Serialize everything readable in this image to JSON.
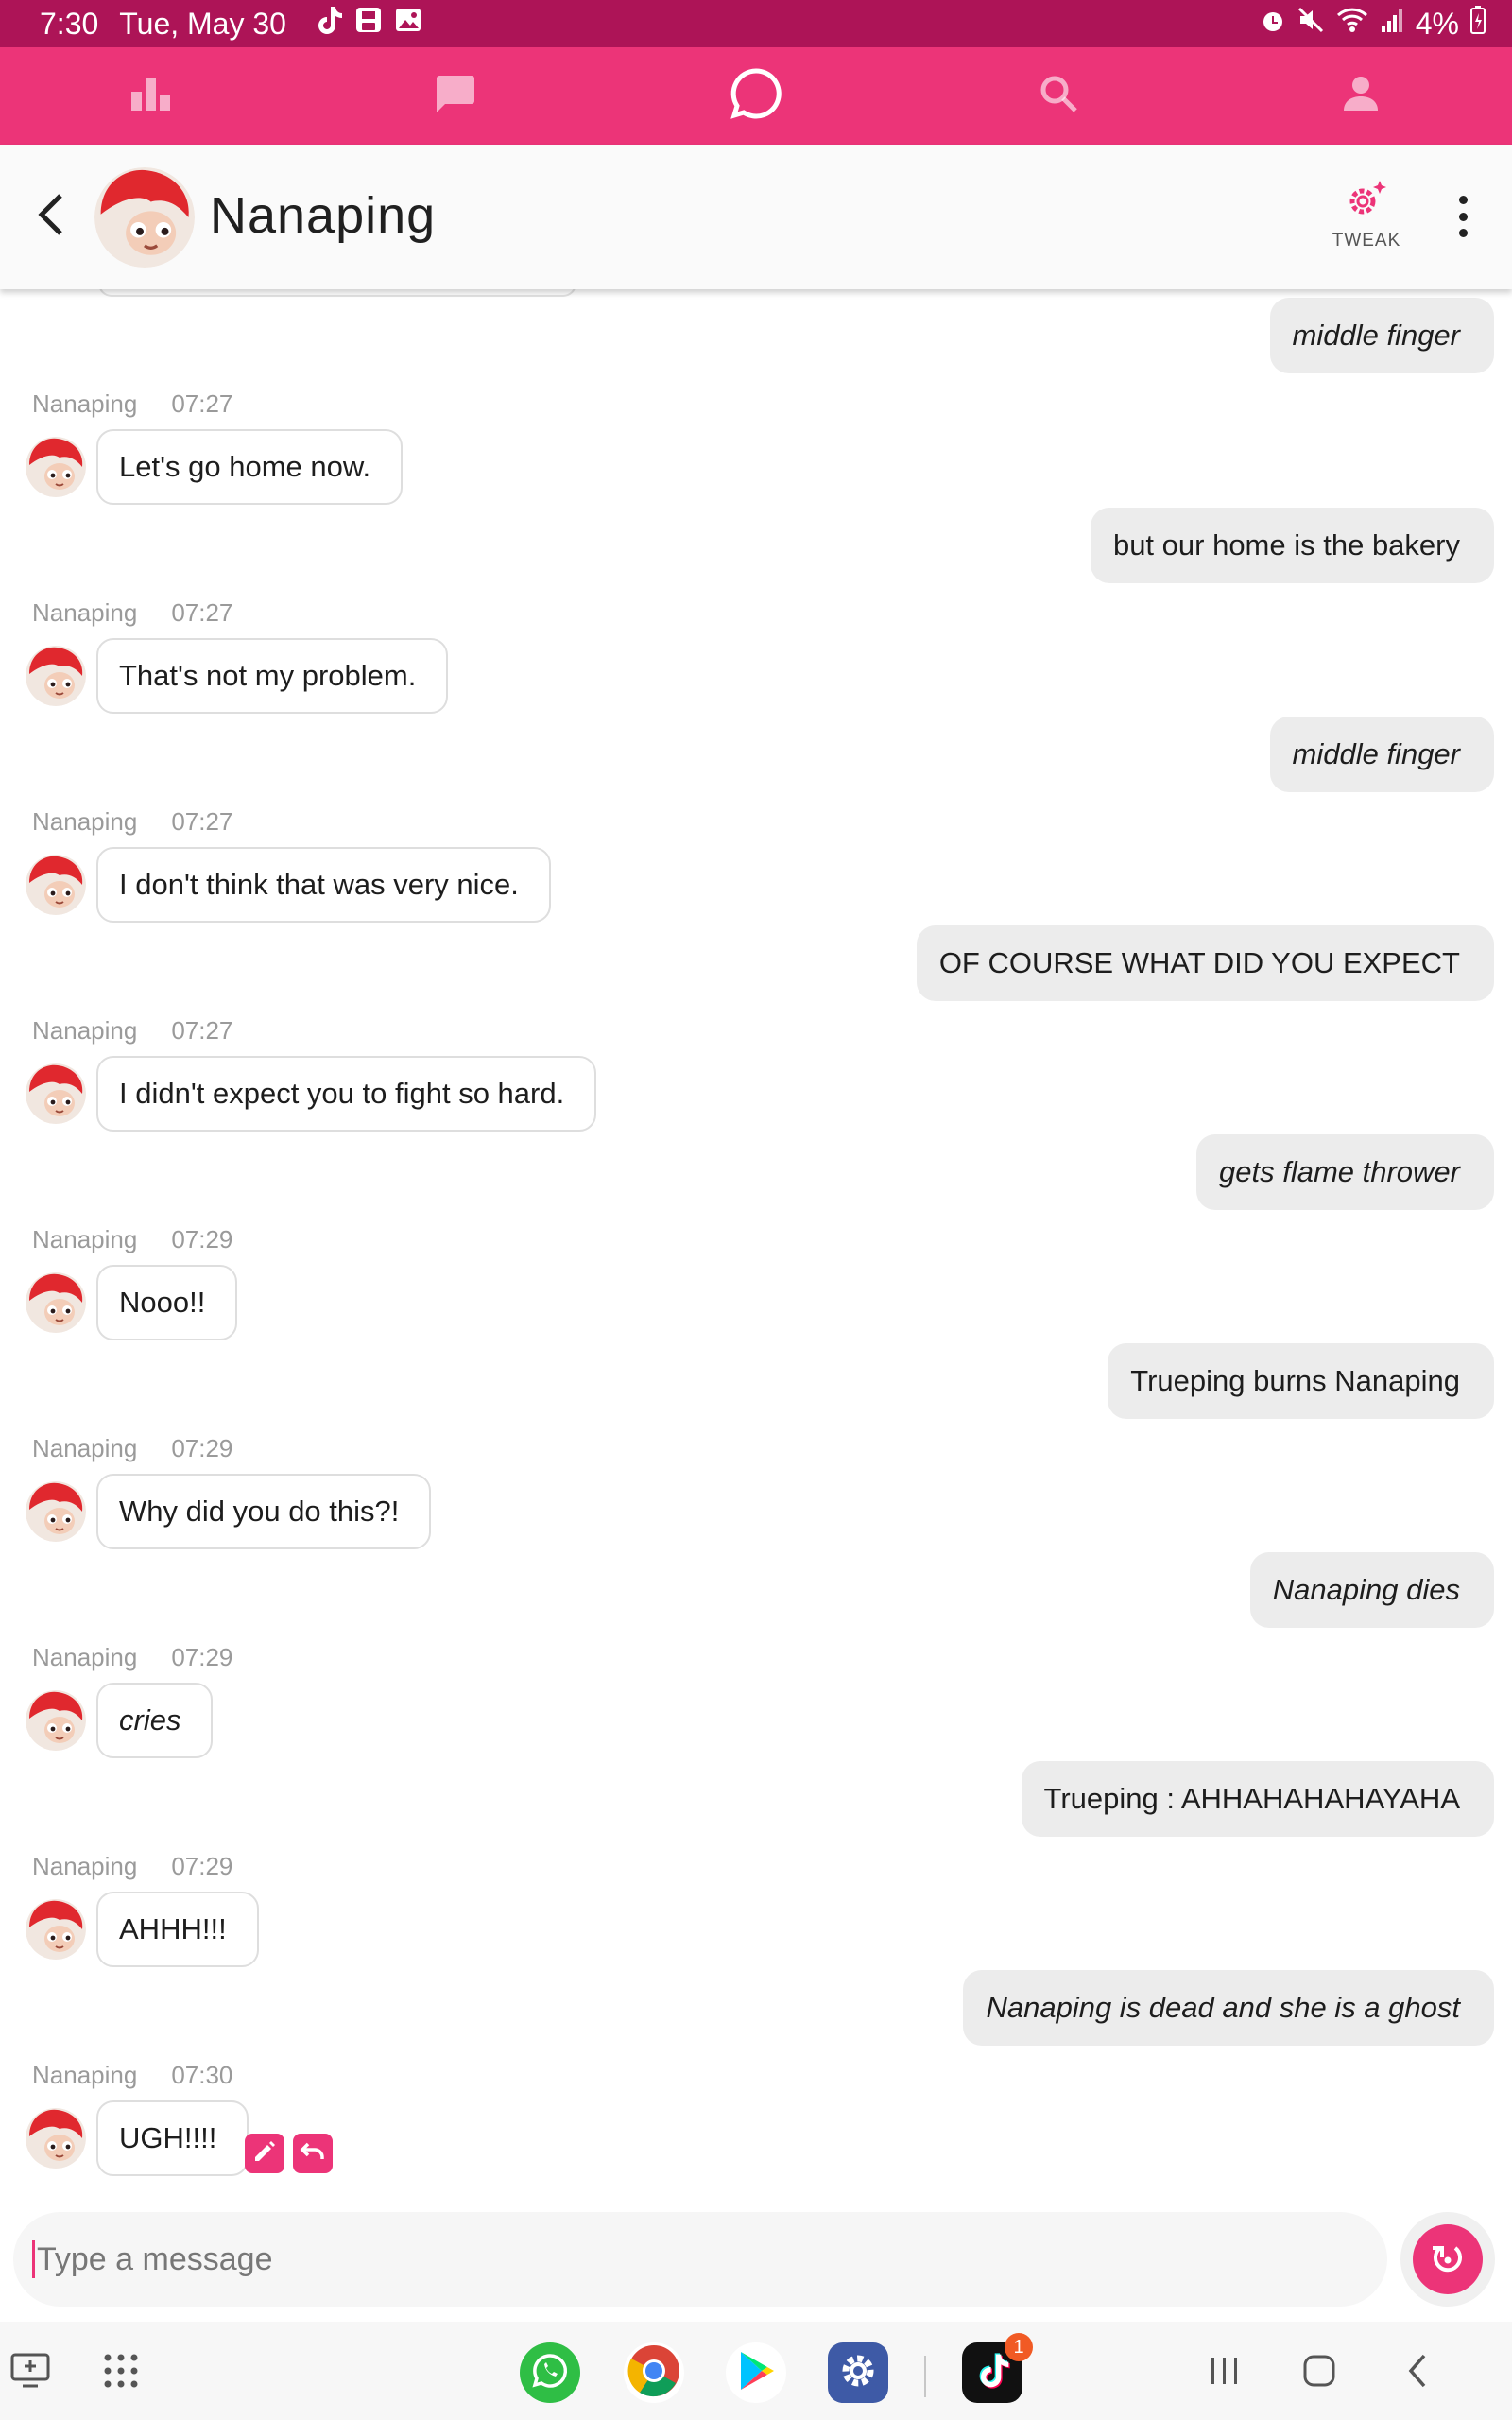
{
  "status_bar": {
    "time": "7:30",
    "date": "Tue, May 30",
    "battery": "4%",
    "left_icons": [
      "tiktok-icon",
      "save-icon",
      "image-icon"
    ],
    "right_icons": [
      "alarm-icon",
      "mute-icon",
      "wifi-icon",
      "signal-icon",
      "battery-icon"
    ]
  },
  "top_nav": {
    "accent": "#ec3478",
    "items": [
      "chart-icon",
      "chat-icon",
      "message-circle-icon",
      "search-icon",
      "person-icon"
    ],
    "active_index": 2
  },
  "header": {
    "name": "Nanaping",
    "tweak_label": "TWEAK"
  },
  "messages": [
    {
      "dir": "out",
      "text": "middle finger",
      "italic": true
    },
    {
      "dir": "in",
      "sender": "Nanaping",
      "time": "07:27",
      "text": "Let's go home now.",
      "italic": false
    },
    {
      "dir": "out",
      "text": "but our home is the bakery",
      "italic": false
    },
    {
      "dir": "in",
      "sender": "Nanaping",
      "time": "07:27",
      "text": "That's not my problem.",
      "italic": false
    },
    {
      "dir": "out",
      "text": "middle finger",
      "italic": true
    },
    {
      "dir": "in",
      "sender": "Nanaping",
      "time": "07:27",
      "text": "I don't think that was very nice.",
      "italic": false
    },
    {
      "dir": "out",
      "text": "OF COURSE WHAT DID YOU EXPECT",
      "italic": false
    },
    {
      "dir": "in",
      "sender": "Nanaping",
      "time": "07:27",
      "text": "I didn't expect you to fight so hard.",
      "italic": false
    },
    {
      "dir": "out",
      "text": "gets flame thrower",
      "italic": true
    },
    {
      "dir": "in",
      "sender": "Nanaping",
      "time": "07:29",
      "text": "Nooo!!",
      "italic": false
    },
    {
      "dir": "out",
      "text": "Trueping burns Nanaping",
      "italic": false
    },
    {
      "dir": "in",
      "sender": "Nanaping",
      "time": "07:29",
      "text": "Why did you do this?!",
      "italic": false
    },
    {
      "dir": "out",
      "text": "Nanaping dies",
      "italic": true
    },
    {
      "dir": "in",
      "sender": "Nanaping",
      "time": "07:29",
      "text": "cries",
      "italic": true
    },
    {
      "dir": "out",
      "text": "Trueping : AHHAHAHAHAYAHA",
      "italic": false
    },
    {
      "dir": "in",
      "sender": "Nanaping",
      "time": "07:29",
      "text": "AHHH!!!",
      "italic": false
    },
    {
      "dir": "out",
      "text": "Nanaping is dead and she is a ghost",
      "italic": true
    },
    {
      "dir": "in",
      "sender": "Nanaping",
      "time": "07:30",
      "text": "UGH!!!!",
      "italic": false,
      "actions": [
        "edit-icon",
        "undo-icon"
      ]
    }
  ],
  "composer": {
    "placeholder": "Type a message",
    "send_icon": "regenerate-icon"
  },
  "system_nav": {
    "apps": [
      "whatsapp-icon",
      "chrome-icon",
      "play-store-icon",
      "settings-icon",
      "tiktok-icon"
    ],
    "tiktok_badge": "1",
    "buttons": [
      "recents-icon",
      "home-icon",
      "back-icon"
    ]
  }
}
